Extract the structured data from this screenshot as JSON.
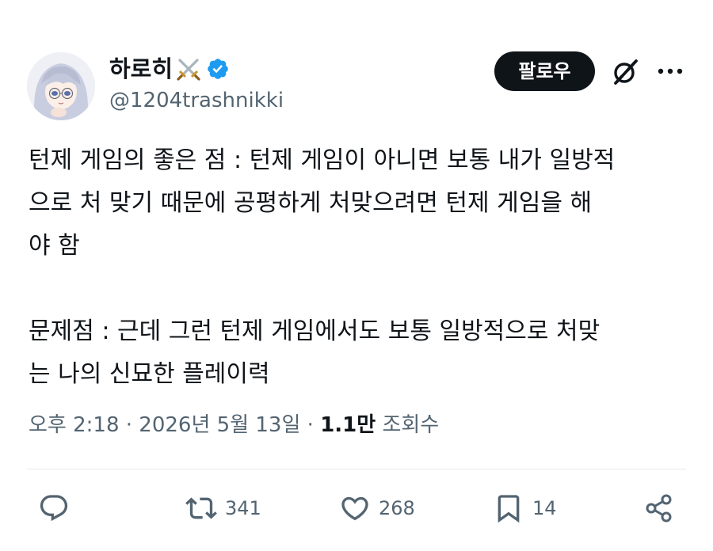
{
  "author": {
    "display_name": "하로히",
    "badge_emoji_icon": "crossed-swords-icon",
    "verified_icon": "verified-badge-icon",
    "handle": "@1204trashnikki",
    "avatar": "avatar-anime-character"
  },
  "header": {
    "follow_label": "팔로우",
    "grok_icon": "grok-icon",
    "more_icon": "more-horizontal-icon"
  },
  "tweet": {
    "text": "턴제 게임의 좋은 점 : 턴제 게임이 아니면 보통 내가 일방적\n으로 처 맞기 때문에 공평하게 처맞으려면 턴제 게임을 해\n야 함\n\n문제점 : 근데 그런 턴제 게임에서도 보통 일방적으로 처맞\n는 나의 신묘한 플레이력"
  },
  "meta": {
    "time": "오후 2:18",
    "separator": "·",
    "date": "2026년 5월 13일",
    "views_count": "1.1만",
    "views_label": "조회수"
  },
  "actions": {
    "reply": {
      "icon": "reply-icon",
      "count": ""
    },
    "retweet": {
      "icon": "retweet-icon",
      "count": "341"
    },
    "like": {
      "icon": "like-heart-icon",
      "count": "268"
    },
    "bookmark": {
      "icon": "bookmark-icon",
      "count": "14"
    },
    "share": {
      "icon": "share-icon",
      "count": ""
    }
  },
  "colors": {
    "text_primary": "#0f1419",
    "text_secondary": "#536471",
    "verified_blue": "#1d9bf0",
    "button_bg": "#0f1419",
    "divider": "#e7e9ea"
  }
}
